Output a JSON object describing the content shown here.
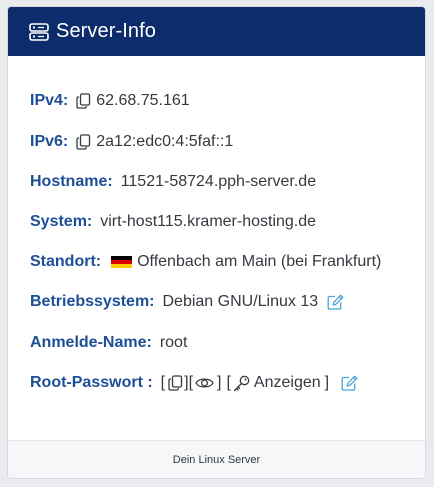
{
  "header": {
    "title": "Server-Info",
    "icon": "server-icon"
  },
  "rows": {
    "ipv4": {
      "label": "IPv4:",
      "value": "62.68.75.161",
      "icon": "copy-icon"
    },
    "ipv6": {
      "label": "IPv6:",
      "value": "2a12:edc0:4:5faf::1",
      "icon": "copy-icon"
    },
    "hostname": {
      "label": "Hostname:",
      "value": "11521-58724.pph-server.de"
    },
    "system": {
      "label": "System:",
      "value": "virt-host115.kramer-hosting.de"
    },
    "standort": {
      "label": "Standort:",
      "value": "Offenbach am Main (bei Frankfurt)",
      "flag": "germany-flag"
    },
    "os": {
      "label": "Betriebssystem:",
      "value": "Debian GNU/Linux 13",
      "icon": "edit-icon"
    },
    "login": {
      "label": "Anmelde-Name:",
      "value": "root"
    },
    "root_password": {
      "label": "Root-Passwort :",
      "open1": "[",
      "mid1": "][",
      "close1": "]",
      "open2": "[",
      "show_label": "Anzeigen",
      "close2": "]",
      "icons": [
        "copy-icon",
        "eye-icon",
        "key-icon",
        "edit-icon"
      ]
    }
  },
  "footer": {
    "text": "Dein Linux Server"
  },
  "colors": {
    "header_bg": "#0c2c6b",
    "label": "#1d4f97",
    "edit_icon": "#4aa3d8",
    "flag": [
      "#000000",
      "#dd0000",
      "#ffce00"
    ]
  }
}
